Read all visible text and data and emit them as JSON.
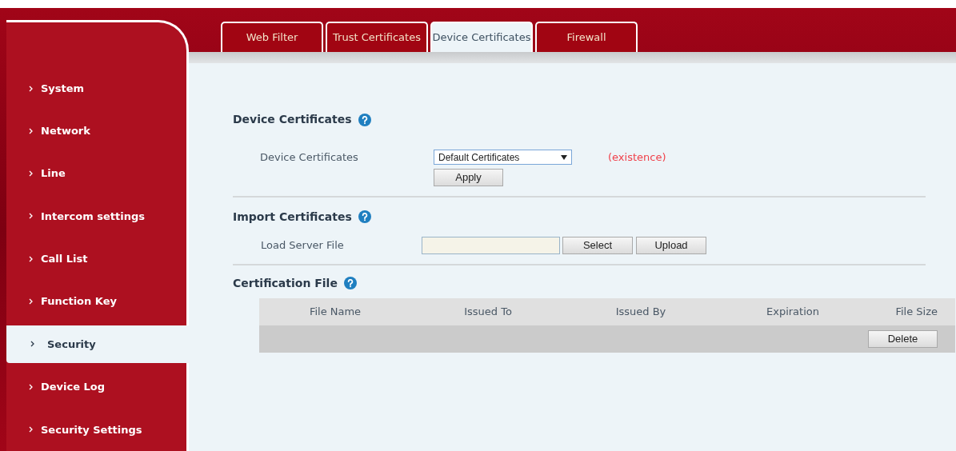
{
  "sidebar": {
    "items": [
      {
        "label": "System",
        "selected": false
      },
      {
        "label": "Network",
        "selected": false
      },
      {
        "label": "Line",
        "selected": false
      },
      {
        "label": "Intercom settings",
        "selected": false
      },
      {
        "label": "Call List",
        "selected": false
      },
      {
        "label": "Function Key",
        "selected": false
      },
      {
        "label": "Security",
        "selected": true
      },
      {
        "label": "Device Log",
        "selected": false
      },
      {
        "label": "Security Settings",
        "selected": false
      }
    ]
  },
  "tabs": [
    {
      "label": "Web Filter",
      "selected": false
    },
    {
      "label": "Trust Certificates",
      "selected": false
    },
    {
      "label": "Device Certificates",
      "selected": true
    },
    {
      "label": "Firewall",
      "selected": false
    }
  ],
  "device_certificates": {
    "title": "Device Certificates",
    "label": "Device Certificates",
    "select_value": "Default Certificates",
    "status": "(existence)",
    "apply_button": "Apply"
  },
  "import_certificates": {
    "title": "Import Certificates",
    "label": "Load Server File",
    "select_button": "Select",
    "upload_button": "Upload"
  },
  "certification_file": {
    "title": "Certification File",
    "columns": [
      "File Name",
      "Issued To",
      "Issued By",
      "Expiration",
      "File Size"
    ],
    "delete_button": "Delete"
  }
}
